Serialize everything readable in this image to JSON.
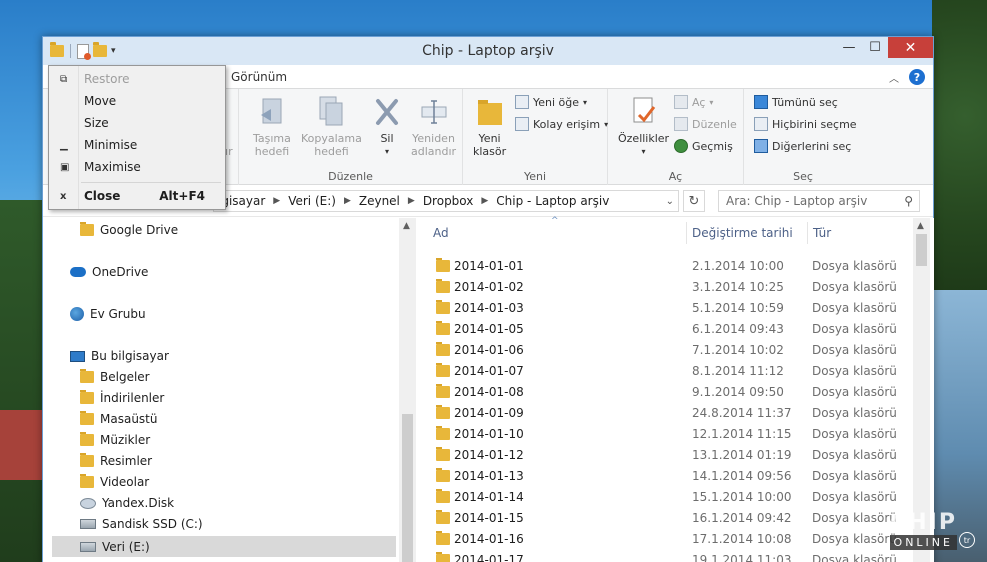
{
  "window": {
    "title": "Chip - Laptop arşiv",
    "controls": {
      "minimize": "—",
      "maximize": "☐",
      "close": "✕"
    }
  },
  "ribbon_tabs": {
    "view": "Görünüm"
  },
  "ribbon": {
    "clipboard_partial": "ştır",
    "organize": {
      "move_to": "Taşıma\nhedefi",
      "copy_to": "Kopyalama\nhedefi",
      "delete": "Sil",
      "rename": "Yeniden\nadlandır",
      "label": "Düzenle"
    },
    "new": {
      "new_folder": "Yeni\nklasör",
      "new_item": "Yeni öğe",
      "easy_access": "Kolay erişim",
      "label": "Yeni"
    },
    "open": {
      "properties": "Özellikler",
      "open": "Aç",
      "edit": "Düzenle",
      "history": "Geçmiş",
      "label": "Aç"
    },
    "select": {
      "select_all": "Tümünü seç",
      "select_none": "Hiçbirini seçme",
      "invert": "Diğerlerini seç",
      "label": "Seç"
    }
  },
  "address": {
    "crumbs": [
      "lgisayar",
      "Veri (E:)",
      "Zeynel",
      "Dropbox",
      "Chip - Laptop arşiv"
    ],
    "search_placeholder": "Ara: Chip - Laptop arşiv"
  },
  "nav": {
    "items": [
      {
        "label": "Google Drive",
        "icon": "folder-icon"
      },
      {
        "label": "OneDrive",
        "icon": "cloud-icon"
      },
      {
        "label": "Ev Grubu",
        "icon": "homegroup-icon"
      },
      {
        "label": "Bu bilgisayar",
        "icon": "computer-icon"
      },
      {
        "label": "Belgeler",
        "icon": "folder-icon"
      },
      {
        "label": "İndirilenler",
        "icon": "folder-icon"
      },
      {
        "label": "Masaüstü",
        "icon": "folder-icon"
      },
      {
        "label": "Müzikler",
        "icon": "folder-icon"
      },
      {
        "label": "Resimler",
        "icon": "folder-icon"
      },
      {
        "label": "Videolar",
        "icon": "folder-icon"
      },
      {
        "label": "Yandex.Disk",
        "icon": "yandex-icon"
      },
      {
        "label": "Sandisk SSD (C:)",
        "icon": "drive-icon"
      },
      {
        "label": "Veri (E:)",
        "icon": "drive-icon"
      }
    ]
  },
  "list": {
    "columns": {
      "name": "Ad",
      "date": "Değiştirme tarihi",
      "type": "Tür"
    },
    "rows": [
      {
        "name": "2014-01-01",
        "date": "2.1.2014 10:00",
        "type": "Dosya klasörü"
      },
      {
        "name": "2014-01-02",
        "date": "3.1.2014 10:25",
        "type": "Dosya klasörü"
      },
      {
        "name": "2014-01-03",
        "date": "5.1.2014 10:59",
        "type": "Dosya klasörü"
      },
      {
        "name": "2014-01-05",
        "date": "6.1.2014 09:43",
        "type": "Dosya klasörü"
      },
      {
        "name": "2014-01-06",
        "date": "7.1.2014 10:02",
        "type": "Dosya klasörü"
      },
      {
        "name": "2014-01-07",
        "date": "8.1.2014 11:12",
        "type": "Dosya klasörü"
      },
      {
        "name": "2014-01-08",
        "date": "9.1.2014 09:50",
        "type": "Dosya klasörü"
      },
      {
        "name": "2014-01-09",
        "date": "24.8.2014 11:37",
        "type": "Dosya klasörü"
      },
      {
        "name": "2014-01-10",
        "date": "12.1.2014 11:15",
        "type": "Dosya klasörü"
      },
      {
        "name": "2014-01-12",
        "date": "13.1.2014 01:19",
        "type": "Dosya klasörü"
      },
      {
        "name": "2014-01-13",
        "date": "14.1.2014 09:56",
        "type": "Dosya klasörü"
      },
      {
        "name": "2014-01-14",
        "date": "15.1.2014 10:00",
        "type": "Dosya klasörü"
      },
      {
        "name": "2014-01-15",
        "date": "16.1.2014 09:42",
        "type": "Dosya klasörü"
      },
      {
        "name": "2014-01-16",
        "date": "17.1.2014 10:08",
        "type": "Dosya klasörü"
      },
      {
        "name": "2014-01-17",
        "date": "19.1.2014 11:03",
        "type": "Dosya klasörü"
      }
    ]
  },
  "system_menu": {
    "restore": "Restore",
    "move": "Move",
    "size": "Size",
    "minimise": "Minimise",
    "maximise": "Maximise",
    "close": "Close",
    "close_shortcut": "Alt+F4"
  },
  "watermark": {
    "brand": "CHIP",
    "online": "ONLINE",
    "country": "tr"
  }
}
